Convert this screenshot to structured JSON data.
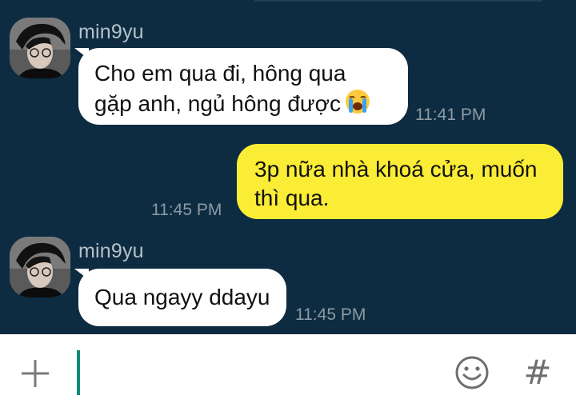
{
  "messages": [
    {
      "direction": "incoming",
      "sender": "min9yu",
      "lines": [
        "Cho em qua đi, hông qua",
        "gặp anh, ngủ hông được"
      ],
      "emoji": "loudly-crying-face-emoji",
      "time": "11:41 PM"
    },
    {
      "direction": "outgoing",
      "lines": [
        "3p nữa nhà khoá cửa, muốn",
        "thì qua."
      ],
      "time": "11:45 PM"
    },
    {
      "direction": "incoming",
      "sender": "min9yu",
      "lines": [
        "Qua ngayy ddayu"
      ],
      "time": "11:45 PM"
    }
  ],
  "composer": {
    "value": "",
    "placeholder": "",
    "attach_icon": "plus-icon",
    "emoji_icon": "smiley-icon",
    "hashtag_icon": "hash-icon",
    "hashtag_label": "#"
  },
  "colors": {
    "chat_background": "#0d2c42",
    "incoming_bubble": "#ffffff",
    "outgoing_bubble": "#fbec35",
    "cursor": "#108a7a",
    "timestamp": "#8d9aa3",
    "sender_name": "#b8c1c8"
  }
}
